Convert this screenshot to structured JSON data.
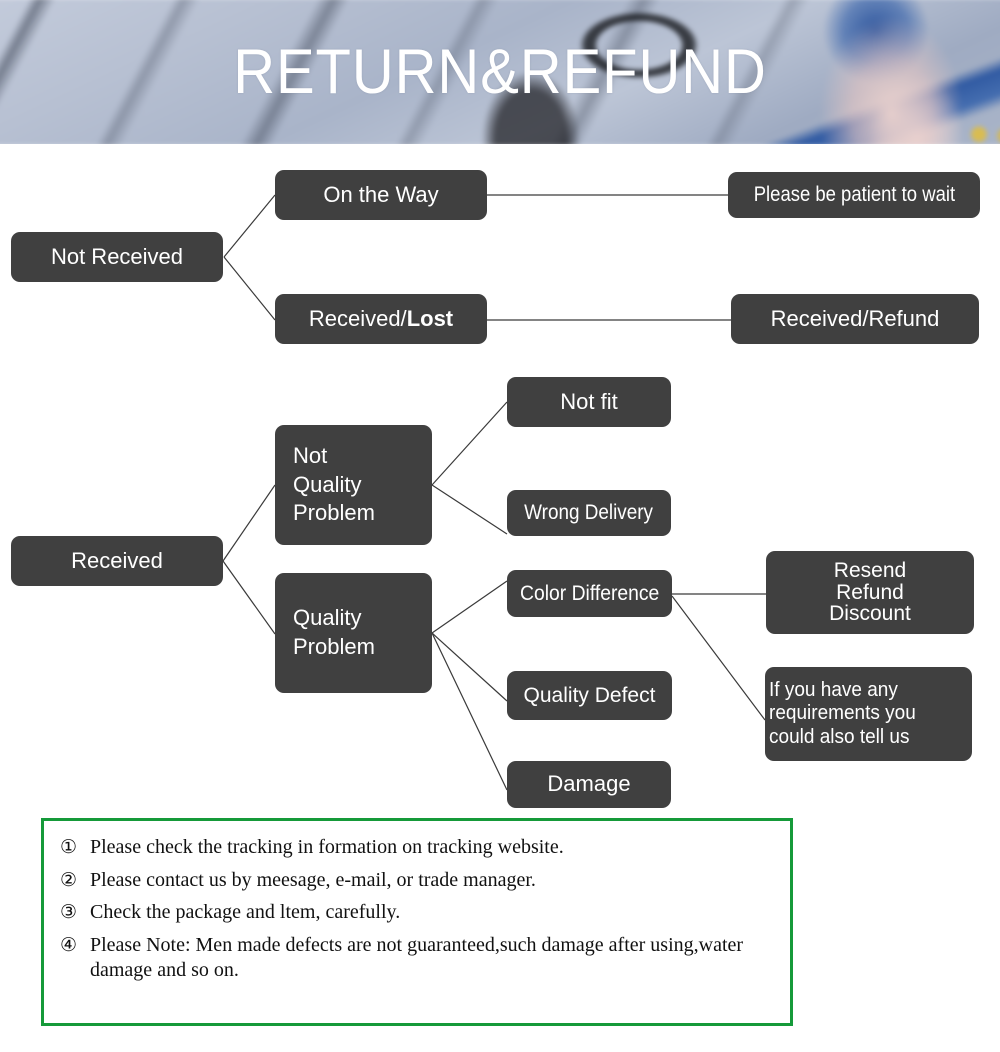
{
  "banner": {
    "title": "RETURN&REFUND",
    "image_description": "blurred photo of a wooden deck with a bicycle and a person's leg in blue denim shorts"
  },
  "colors": {
    "node_fill": "#404040",
    "node_text": "#ffffff",
    "connector": "#3a3a3a",
    "notes_border": "#159a39",
    "page_background": "#ffffff"
  },
  "flowchart": {
    "nodes": [
      {
        "id": "not-received",
        "label": "Not Received"
      },
      {
        "id": "on-the-way",
        "label": "On the Way"
      },
      {
        "id": "received-lost",
        "label": "Received/",
        "label_bold": "Lost"
      },
      {
        "id": "please-be-patient",
        "label": "Please be patient to wait"
      },
      {
        "id": "received-refund",
        "label": "Received/Refund"
      },
      {
        "id": "received",
        "label": "Received"
      },
      {
        "id": "not-quality-problem",
        "label": "Not\nQuality\nProblem"
      },
      {
        "id": "quality-problem",
        "label": "Quality\nProblem"
      },
      {
        "id": "not-fit",
        "label": "Not fit"
      },
      {
        "id": "wrong-delivery",
        "label": "Wrong Delivery"
      },
      {
        "id": "color-difference",
        "label": "Color Difference"
      },
      {
        "id": "quality-defect",
        "label": "Quality Defect"
      },
      {
        "id": "damage",
        "label": "Damage"
      },
      {
        "id": "resend-refund-discount",
        "label": "Resend\nRefund\nDiscount"
      },
      {
        "id": "tell-us",
        "label": "If you have any\nrequirements you\ncould also tell us"
      }
    ],
    "edges": [
      {
        "from": "not-received",
        "to": "on-the-way"
      },
      {
        "from": "not-received",
        "to": "received-lost"
      },
      {
        "from": "on-the-way",
        "to": "please-be-patient"
      },
      {
        "from": "received-lost",
        "to": "received-refund"
      },
      {
        "from": "received",
        "to": "not-quality-problem"
      },
      {
        "from": "received",
        "to": "quality-problem"
      },
      {
        "from": "not-quality-problem",
        "to": "not-fit"
      },
      {
        "from": "not-quality-problem",
        "to": "wrong-delivery"
      },
      {
        "from": "quality-problem",
        "to": "color-difference"
      },
      {
        "from": "quality-problem",
        "to": "quality-defect"
      },
      {
        "from": "quality-problem",
        "to": "damage"
      },
      {
        "from": "color-difference",
        "to": "resend-refund-discount"
      },
      {
        "from": "color-difference",
        "to": "tell-us"
      }
    ]
  },
  "notes": [
    {
      "number": "①",
      "text": "Please check the tracking in formation on tracking website."
    },
    {
      "number": "②",
      "text": "Please contact us by meesage, e-mail, or trade manager."
    },
    {
      "number": "③",
      "text": "Check the package and ltem, carefully."
    },
    {
      "number": "④",
      "text": "Please Note: Men made defects  are not guaranteed,such damage after using,water damage and so on."
    }
  ]
}
